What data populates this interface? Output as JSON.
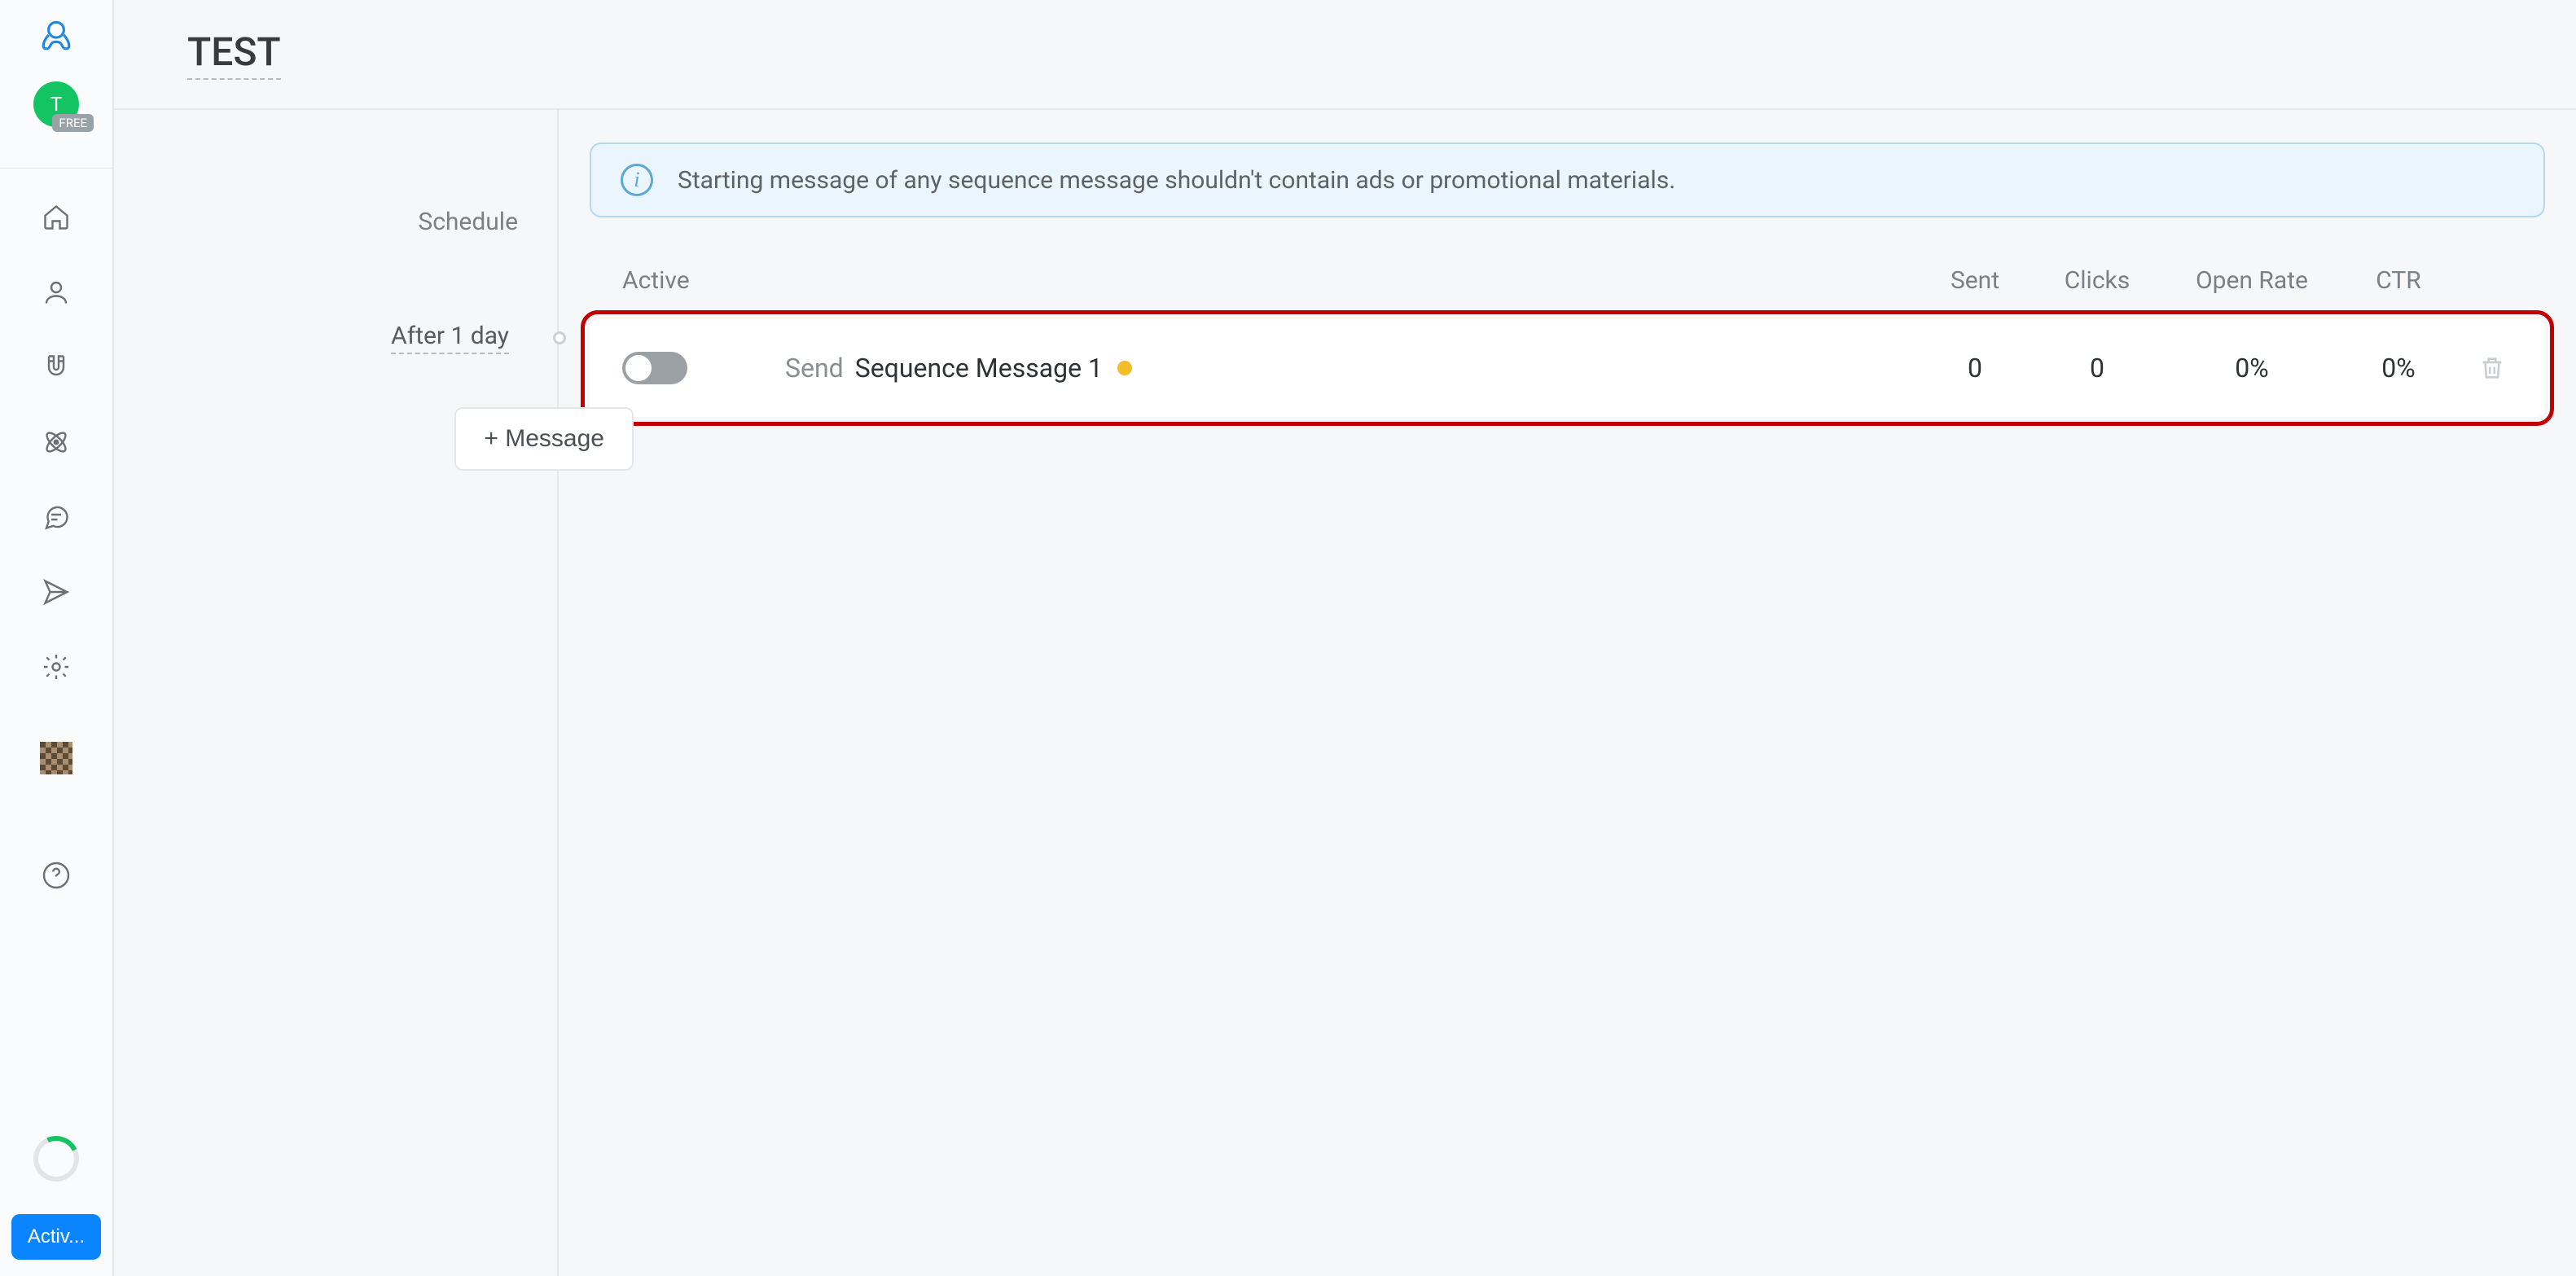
{
  "sidebar": {
    "avatar_letter": "T",
    "avatar_badge": "FREE",
    "activ_label": "Activ..."
  },
  "header": {
    "title": "TEST"
  },
  "info_banner": {
    "text": "Starting message of any sequence message shouldn't contain ads or promotional materials."
  },
  "columns": {
    "schedule": "Schedule",
    "active": "Active",
    "sent": "Sent",
    "clicks": "Clicks",
    "open_rate": "Open Rate",
    "ctr": "CTR"
  },
  "rows": [
    {
      "schedule": "After 1 day",
      "send_label": "Send",
      "name": "Sequence Message 1",
      "sent": "0",
      "clicks": "0",
      "open_rate": "0%",
      "ctr": "0%"
    }
  ],
  "buttons": {
    "add_message": "+ Message"
  }
}
